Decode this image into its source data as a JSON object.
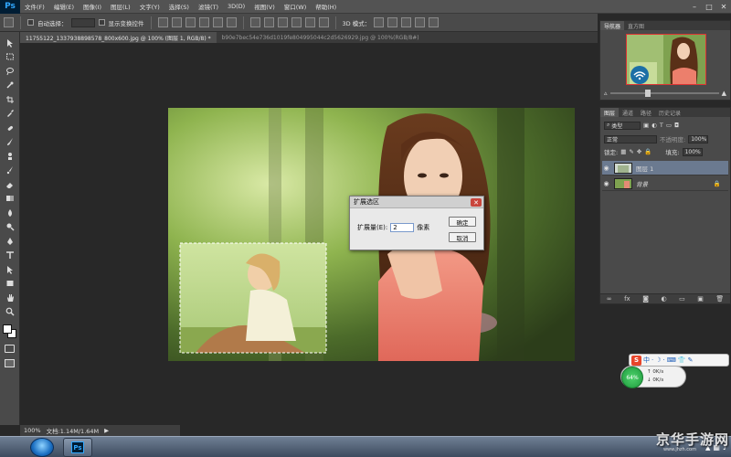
{
  "app": {
    "logo": "Ps",
    "menu": [
      "文件(F)",
      "编辑(E)",
      "图像(I)",
      "图层(L)",
      "文字(Y)",
      "选择(S)",
      "滤镜(T)",
      "3D(D)",
      "视图(V)",
      "窗口(W)",
      "帮助(H)"
    ],
    "window_controls": [
      "–",
      "□",
      "✕"
    ]
  },
  "options_bar": {
    "auto_select_label": "自动选择：",
    "show_transform_label": "显示变换控件",
    "mode_3d_label": "3D 模式："
  },
  "tabs": [
    {
      "label": "11755122_1337938898578_800x600.jpg @ 100% (图层 1, RGB/8) *",
      "active": true
    },
    {
      "label": "b90e7bec54e736d1019fe804995044c2d5626929.jpg @ 100%(RGB/8#)",
      "active": false
    }
  ],
  "toolbar": {
    "icons": [
      "move-icon",
      "marquee-icon",
      "lasso-icon",
      "quick-select-icon",
      "crop-icon",
      "eyedropper-icon",
      "healing-brush-icon",
      "brush-icon",
      "clone-stamp-icon",
      "history-brush-icon",
      "eraser-icon",
      "gradient-icon",
      "blur-icon",
      "dodge-icon",
      "pen-icon",
      "type-icon",
      "path-select-icon",
      "shape-icon",
      "hand-icon",
      "zoom-icon"
    ]
  },
  "dialog": {
    "title": "扩展选区",
    "close": "✕",
    "field_label": "扩展量(E):",
    "field_value": "2",
    "unit": "像素",
    "ok": "确定",
    "cancel": "取消"
  },
  "navigator": {
    "tabs": [
      "导航器",
      "直方图"
    ],
    "zoom": "100%"
  },
  "layers_panel": {
    "tabs": [
      "图层",
      "通道",
      "路径",
      "历史记录"
    ],
    "filter_label": "类型",
    "blend_mode": "正常",
    "opacity_label": "不透明度:",
    "opacity_value": "100%",
    "lock_label": "锁定:",
    "fill_label": "填充:",
    "fill_value": "100%",
    "layers": [
      {
        "name": "图层 1",
        "active": true
      },
      {
        "name": "背景",
        "active": false
      }
    ],
    "footer_icons": [
      "link-icon",
      "fx-icon",
      "mask-icon",
      "adjustment-icon",
      "folder-icon",
      "new-layer-icon",
      "trash-icon"
    ],
    "footer_fx": "fx"
  },
  "statusbar": {
    "zoom": "100%",
    "doc_info": "文档:1.14M/1.64M",
    "arrow": "▶"
  },
  "ime": {
    "logo": "S",
    "mode": "中",
    "symbols": [
      "·",
      "☽",
      "·",
      "⌨",
      "👕",
      "✎"
    ]
  },
  "speed_widget": {
    "percent": "64%",
    "up": "0K/s",
    "down": "0K/s"
  },
  "watermark": "京华手游网",
  "watermark_sub": "www.jhzh.com",
  "colors": {
    "ps_blue": "#31a8ff",
    "panel_bg": "#4a4a4a",
    "active_layer": "#6b7a90"
  }
}
